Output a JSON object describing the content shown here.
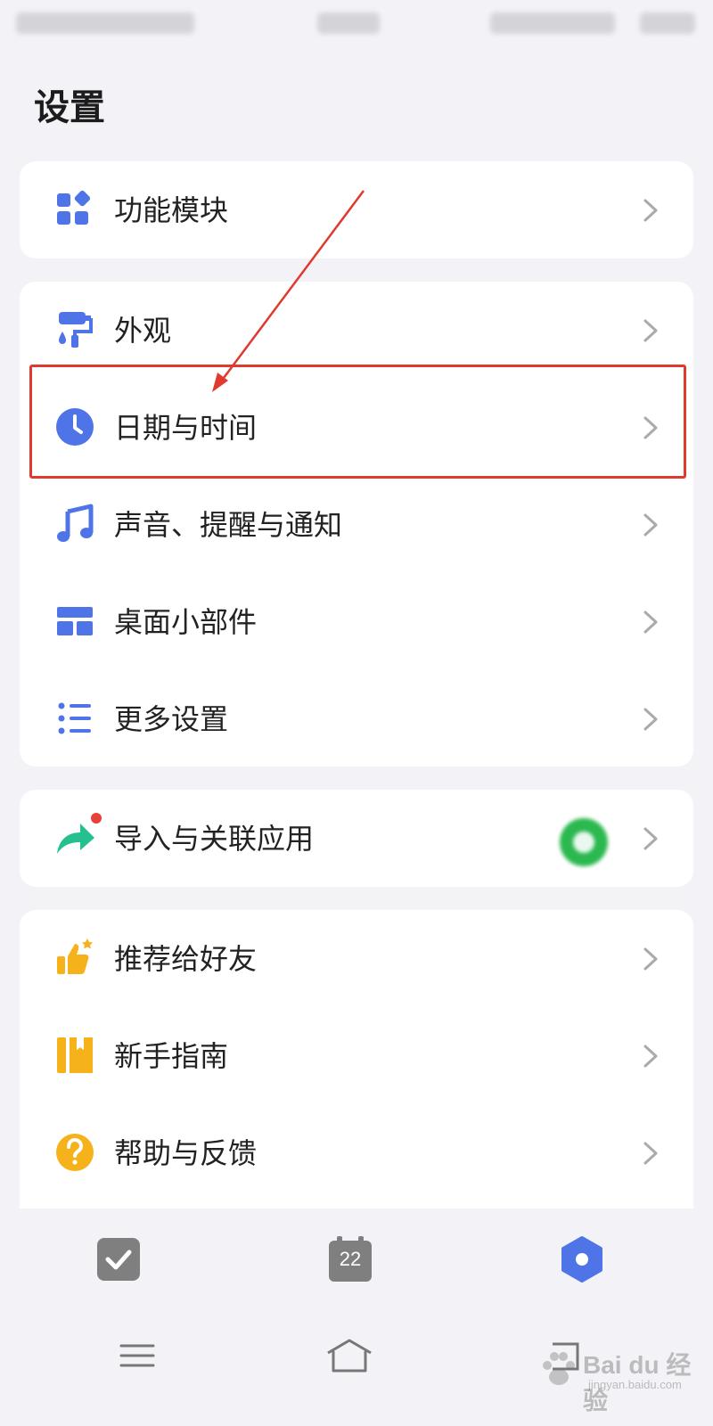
{
  "page": {
    "title": "设置"
  },
  "colors": {
    "blue": "#4f74e8",
    "green": "#25c08f",
    "orange": "#f6b21a",
    "highlight": "#e03a2f",
    "tab_inactive": "#7f7f7f",
    "tab_active": "#4f74e8"
  },
  "groups": [
    {
      "items": [
        {
          "label": "功能模块",
          "icon": "apps-icon"
        }
      ]
    },
    {
      "items": [
        {
          "label": "外观",
          "icon": "paint-roller-icon"
        },
        {
          "label": "日期与时间",
          "icon": "clock-icon",
          "highlighted": true
        },
        {
          "label": "声音、提醒与通知",
          "icon": "music-note-icon"
        },
        {
          "label": "桌面小部件",
          "icon": "widget-icon"
        },
        {
          "label": "更多设置",
          "icon": "list-icon"
        }
      ]
    },
    {
      "items": [
        {
          "label": "导入与关联应用",
          "icon": "share-arrow-icon",
          "badge": "red-dot",
          "trailing_icon": "linked-app-icon"
        }
      ]
    },
    {
      "items": [
        {
          "label": "推荐给好友",
          "icon": "thumbs-up-icon"
        },
        {
          "label": "新手指南",
          "icon": "book-icon"
        },
        {
          "label": "帮助与反馈",
          "icon": "help-icon"
        }
      ]
    }
  ],
  "tabbar": {
    "tabs": [
      {
        "name": "tasks",
        "icon": "checkbox-icon",
        "active": false
      },
      {
        "name": "calendar",
        "icon": "calendar-icon",
        "date": "22",
        "active": false
      },
      {
        "name": "settings",
        "icon": "hexagon-settings-icon",
        "active": true
      }
    ]
  },
  "system_nav": {
    "buttons": [
      "menu-icon",
      "home-icon",
      "back-icon"
    ]
  },
  "watermark": {
    "text": "Bai du 经验",
    "sub": "jingyan.baidu.com"
  }
}
